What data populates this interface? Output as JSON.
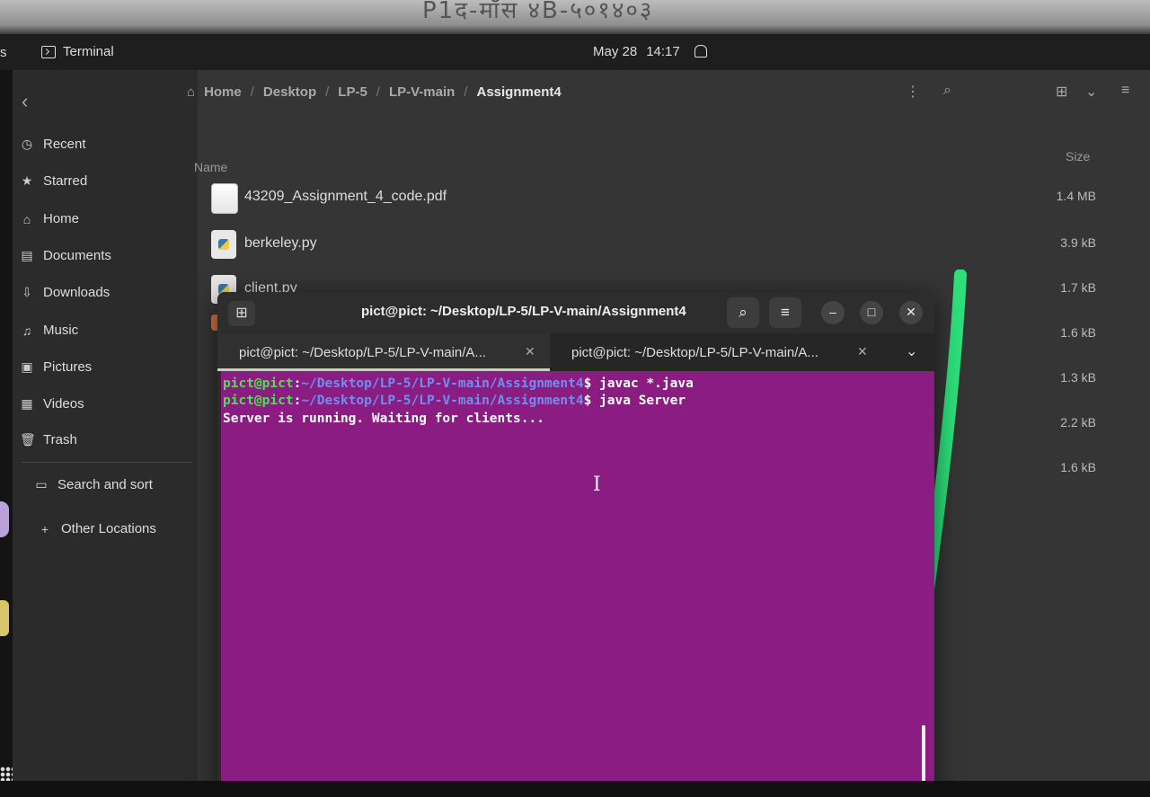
{
  "bezel_text": "P1द-मॉस ४B-५०१४०३",
  "topbar": {
    "activities_fragment": "s",
    "app_name": "Terminal",
    "date": "May 28",
    "time": "14:17"
  },
  "sidebar": {
    "items": [
      {
        "label": "Recent",
        "icon": "clock-icon"
      },
      {
        "label": "Starred",
        "icon": "star-icon"
      },
      {
        "label": "Home",
        "icon": "home-icon"
      },
      {
        "label": "Documents",
        "icon": "document-icon"
      },
      {
        "label": "Downloads",
        "icon": "download-icon"
      },
      {
        "label": "Music",
        "icon": "music-icon"
      },
      {
        "label": "Pictures",
        "icon": "picture-icon"
      },
      {
        "label": "Videos",
        "icon": "video-icon"
      },
      {
        "label": "Trash",
        "icon": "trash-icon"
      }
    ],
    "search_and_sort": "Search and sort",
    "other_locations": "Other Locations"
  },
  "breadcrumb": [
    "Home",
    "Desktop",
    "LP-5",
    "LP-V-main",
    "Assignment4"
  ],
  "columns": {
    "name": "Name",
    "size": "Size"
  },
  "files": [
    {
      "name": "43209_Assignment_4_code.pdf",
      "size": "1.4 MB",
      "type": "pdf"
    },
    {
      "name": "berkeley.py",
      "size": "3.9 kB",
      "type": "py"
    },
    {
      "name": "client.py",
      "size": "1.7 kB",
      "type": "py"
    },
    {
      "name": "",
      "size": "1.6 kB",
      "type": "other"
    },
    {
      "name": "",
      "size": "1.3 kB",
      "type": "hidden"
    },
    {
      "name": "",
      "size": "2.2 kB",
      "type": "hidden"
    },
    {
      "name": "",
      "size": "1.6 kB",
      "type": "hidden"
    }
  ],
  "terminal": {
    "title": "pict@pict: ~/Desktop/LP-5/LP-V-main/Assignment4",
    "tabs": [
      {
        "label": "pict@pict: ~/Desktop/LP-5/LP-V-main/A..."
      },
      {
        "label": "pict@pict: ~/Desktop/LP-5/LP-V-main/A..."
      }
    ],
    "lines": [
      {
        "user": "pict@pict",
        "path": "~/Desktop/LP-5/LP-V-main/Assignment4",
        "cmd": "$ javac *.java"
      },
      {
        "user": "pict@pict",
        "path": "~/Desktop/LP-5/LP-V-main/Assignment4",
        "cmd": "$ java Server"
      }
    ],
    "output": "Server is running. Waiting for clients..."
  },
  "colors": {
    "terminal_bg": "#8b1d82",
    "prompt_user": "#4fe04f",
    "prompt_path": "#6e8ff0",
    "marker": "#2de07a"
  }
}
